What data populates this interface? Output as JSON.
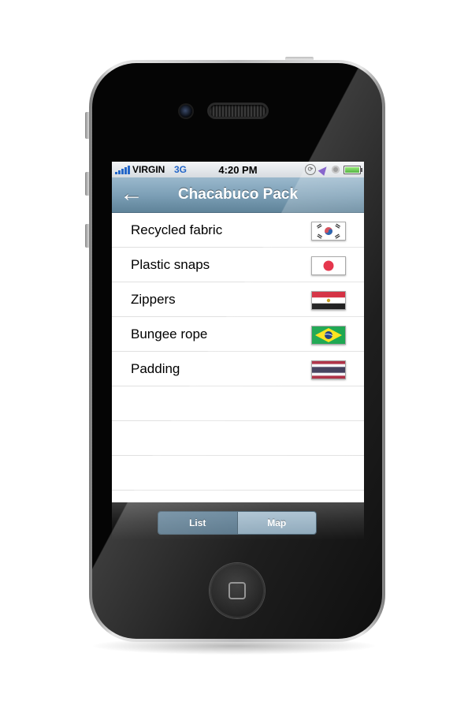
{
  "status_bar": {
    "carrier": "VIRGIN",
    "network": "3G",
    "time": "4:20 PM",
    "signal_bars": 5,
    "battery_level_percent": 100,
    "icons": [
      "rotation-lock-icon",
      "location-arrow-icon",
      "alarm-icon",
      "battery-icon"
    ]
  },
  "nav_bar": {
    "title": "Chacabuco Pack",
    "back_icon": "back-arrow-icon",
    "back_glyph": "←"
  },
  "list": {
    "items": [
      {
        "label": "Recycled fabric",
        "flag": "South Korea"
      },
      {
        "label": "Plastic snaps",
        "flag": "Japan"
      },
      {
        "label": "Zippers",
        "flag": "Egypt"
      },
      {
        "label": "Bungee rope",
        "flag": "Brazil"
      },
      {
        "label": "Padding",
        "flag": "Thailand"
      }
    ],
    "empty_rows": 3
  },
  "tab_bar": {
    "segments": [
      {
        "label": "List",
        "selected": true
      },
      {
        "label": "Map",
        "selected": false
      }
    ]
  },
  "colors": {
    "nav_bar": "#7da0b7",
    "segment_selected": "#4a6a80",
    "segment_unselected": "#86a3b6",
    "status_accent": "#2366c8"
  }
}
